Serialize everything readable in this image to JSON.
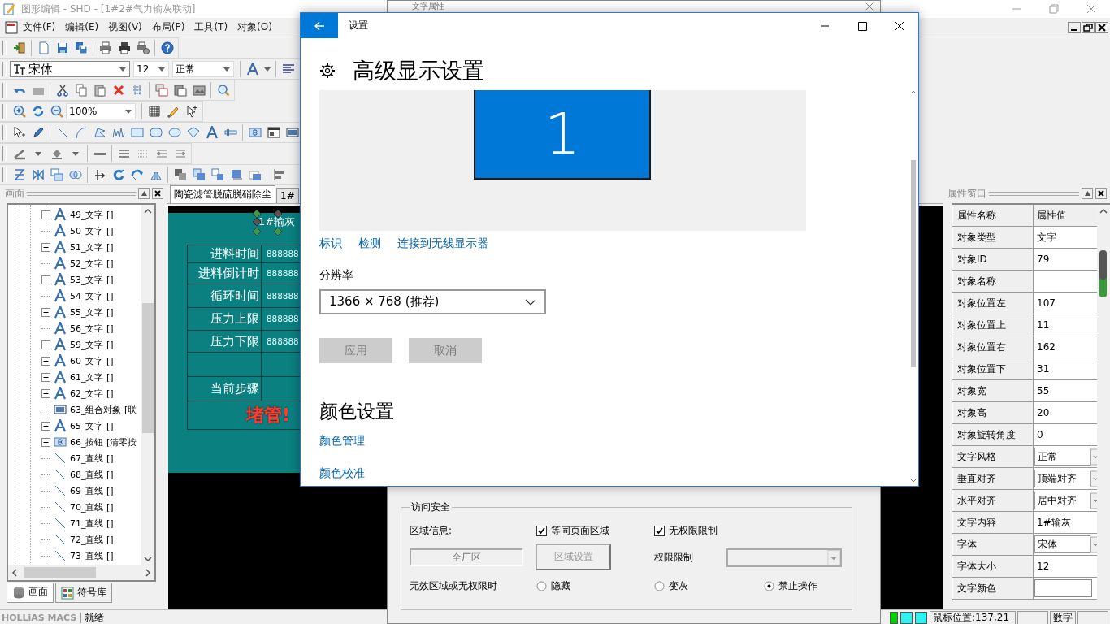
{
  "app_window": {
    "title": "图形编辑 - SHD - [1#2#气力输灰联动]"
  },
  "menu": [
    "文件(F)",
    "编辑(E)",
    "视图(V)",
    "布局(P)",
    "工具(T)",
    "对象(O)"
  ],
  "font_toolbar": {
    "font": "宋体",
    "size": "12",
    "style": "正常"
  },
  "zoom_toolbar": {
    "zoom": "100%"
  },
  "screen_panel": {
    "title": "画面",
    "tree": [
      {
        "label": "49_文字 []",
        "kind": "text",
        "expandable": true
      },
      {
        "label": "50_文字 []",
        "kind": "text",
        "expandable": false
      },
      {
        "label": "51_文字 []",
        "kind": "text",
        "expandable": true
      },
      {
        "label": "52_文字 []",
        "kind": "text",
        "expandable": false
      },
      {
        "label": "53_文字 []",
        "kind": "text",
        "expandable": true
      },
      {
        "label": "54_文字 []",
        "kind": "text",
        "expandable": false
      },
      {
        "label": "55_文字 []",
        "kind": "text",
        "expandable": true
      },
      {
        "label": "56_文字 []",
        "kind": "text",
        "expandable": false
      },
      {
        "label": "59_文字 []",
        "kind": "text",
        "expandable": true
      },
      {
        "label": "60_文字 []",
        "kind": "text",
        "expandable": true
      },
      {
        "label": "61_文字 []",
        "kind": "text",
        "expandable": true
      },
      {
        "label": "62_文字 []",
        "kind": "text",
        "expandable": true
      },
      {
        "label": "63_组合对象 [联",
        "kind": "group",
        "expandable": false
      },
      {
        "label": "65_文字 []",
        "kind": "text",
        "expandable": true
      },
      {
        "label": "66_按钮 [清零按",
        "kind": "button",
        "expandable": true
      },
      {
        "label": "67_直线 []",
        "kind": "line",
        "expandable": false
      },
      {
        "label": "68_直线 []",
        "kind": "line",
        "expandable": false
      },
      {
        "label": "69_直线 []",
        "kind": "line",
        "expandable": false
      },
      {
        "label": "70_直线 []",
        "kind": "line",
        "expandable": false
      },
      {
        "label": "71_直线 []",
        "kind": "line",
        "expandable": false
      },
      {
        "label": "72_直线 []",
        "kind": "line",
        "expandable": false
      },
      {
        "label": "73_直线 []",
        "kind": "line",
        "expandable": false
      }
    ],
    "tabs": [
      {
        "label": "画面",
        "selected": true
      },
      {
        "label": "符号库",
        "selected": false
      }
    ]
  },
  "editor": {
    "tabs": [
      {
        "label": "陶瓷滤管脱硫脱硝除尘",
        "selected": true
      },
      {
        "label": "1#",
        "selected": false
      }
    ],
    "canvas": {
      "title_text": {
        "text": "1#输灰",
        "selected": true
      },
      "rows": [
        {
          "kind": "field",
          "label": "进料时间",
          "value": "888888"
        },
        {
          "kind": "field",
          "label": "进料倒计时",
          "value": "888888"
        },
        {
          "kind": "field",
          "label": "循环时间",
          "value": "888888"
        },
        {
          "kind": "field",
          "label": "压力上限",
          "value": "888888"
        },
        {
          "kind": "field",
          "label": "压力下限",
          "value": "888888"
        },
        {
          "kind": "blank"
        },
        {
          "kind": "field",
          "label": "当前步骤"
        }
      ],
      "alarm": "堵管!"
    }
  },
  "properties_panel": {
    "title": "属性窗口",
    "header": [
      "属性名称",
      "属性值"
    ],
    "rows": [
      {
        "name": "对象类型",
        "kind": "text",
        "value": "文字"
      },
      {
        "name": "对象ID",
        "kind": "text",
        "value": "79"
      },
      {
        "name": "对象名称",
        "kind": "text"
      },
      {
        "name": "对象位置左",
        "kind": "text",
        "value": "107"
      },
      {
        "name": "对象位置上",
        "kind": "text",
        "value": "11"
      },
      {
        "name": "对象位置右",
        "kind": "text",
        "value": "162"
      },
      {
        "name": "对象位置下",
        "kind": "text",
        "value": "31"
      },
      {
        "name": "对象宽",
        "kind": "text",
        "value": "55"
      },
      {
        "name": "对象高",
        "kind": "text",
        "value": "20"
      },
      {
        "name": "对象旋转角度",
        "kind": "text",
        "value": "0"
      },
      {
        "name": "文字风格",
        "kind": "dropdown",
        "value": "正常"
      },
      {
        "name": "垂直对齐",
        "kind": "dropdown",
        "value": "顶端对齐"
      },
      {
        "name": "水平对齐",
        "kind": "dropdown",
        "value": "居中对齐"
      },
      {
        "name": "文字内容",
        "kind": "text",
        "value": "1#输灰"
      },
      {
        "name": "字体",
        "kind": "dropdown",
        "value": "宋体"
      },
      {
        "name": "字体大小",
        "kind": "text",
        "value": "12"
      },
      {
        "name": "文字颜色",
        "kind": "color"
      }
    ]
  },
  "status_bar": {
    "brand": "HOLLiAS MACS",
    "status": "就绪",
    "mouse_position": "鼠标位置:137,21",
    "mode": "数字"
  },
  "text_properties_dialog": {
    "title": "文字属性",
    "access_group": {
      "title": "访问安全",
      "region_label": "区域信息:",
      "same_as_page": {
        "label": "等同页面区域",
        "checked": true
      },
      "no_permission_limit": {
        "label": "无权限限制",
        "checked": true
      },
      "region_value": "全厂区",
      "region_button": {
        "label": "区域设置",
        "disabled": true
      },
      "permission_label": "权限限制",
      "invalid_label": "无效区域或无权限时",
      "actions": [
        {
          "label": "隐藏",
          "selected": false
        },
        {
          "label": "变灰",
          "selected": false
        },
        {
          "label": "禁止操作",
          "selected": true
        }
      ]
    }
  },
  "settings_window": {
    "title": "设置",
    "heading": "高级显示设置",
    "display": {
      "number": "1"
    },
    "links": [
      "标识",
      "检测",
      "连接到无线显示器"
    ],
    "resolution": {
      "label": "分辨率",
      "value": "1366 × 768 (推荐)"
    },
    "buttons": [
      {
        "label": "应用",
        "disabled": true
      },
      {
        "label": "取消",
        "disabled": true
      }
    ],
    "color_section": {
      "heading": "颜色设置",
      "links": [
        "颜色管理",
        "颜色校准"
      ]
    }
  }
}
